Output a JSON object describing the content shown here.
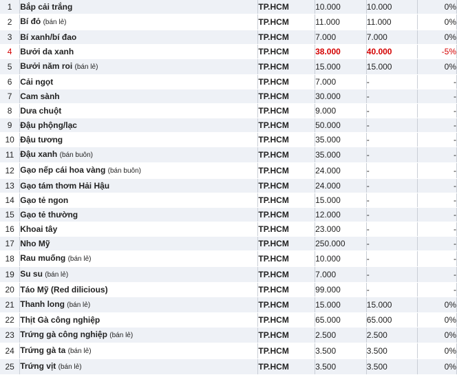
{
  "colors": {
    "row_alt": "#eef1f6",
    "row_white": "#ffffff",
    "highlight": "#d40000",
    "text": "#222222"
  },
  "rows": [
    {
      "stt": "1",
      "name": "Bắp cải trắng",
      "note": "",
      "location": "TP.HCM",
      "price1": "10.000",
      "price2": "10.000",
      "change": "0%"
    },
    {
      "stt": "2",
      "name": "Bí đỏ",
      "note": "(bán lẻ)",
      "location": "TP.HCM",
      "price1": "11.000",
      "price2": "11.000",
      "change": "0%"
    },
    {
      "stt": "3",
      "name": "Bí xanh/bí đao",
      "note": "",
      "location": "TP.HCM",
      "price1": "7.000",
      "price2": "7.000",
      "change": "0%"
    },
    {
      "stt": "4",
      "name": "Bưởi da xanh",
      "note": "",
      "location": "TP.HCM",
      "price1": "38.000",
      "price2": "40.000",
      "change": "-5%",
      "highlight": true
    },
    {
      "stt": "5",
      "name": "Bưởi năm roi",
      "note": "(bán lẻ)",
      "location": "TP.HCM",
      "price1": "15.000",
      "price2": "15.000",
      "change": "0%"
    },
    {
      "stt": "6",
      "name": "Cải ngọt",
      "note": "",
      "location": "TP.HCM",
      "price1": "7.000",
      "price2": "-",
      "change": "-"
    },
    {
      "stt": "7",
      "name": "Cam sành",
      "note": "",
      "location": "TP.HCM",
      "price1": "30.000",
      "price2": "-",
      "change": "-"
    },
    {
      "stt": "8",
      "name": "Dưa chuột",
      "note": "",
      "location": "TP.HCM",
      "price1": "9.000",
      "price2": "-",
      "change": "-"
    },
    {
      "stt": "9",
      "name": "Đậu phộng/lạc",
      "note": "",
      "location": "TP.HCM",
      "price1": "50.000",
      "price2": "-",
      "change": "-"
    },
    {
      "stt": "10",
      "name": "Đậu tương",
      "note": "",
      "location": "TP.HCM",
      "price1": "35.000",
      "price2": "-",
      "change": "-"
    },
    {
      "stt": "11",
      "name": "Đậu xanh",
      "note": "(bán buôn)",
      "location": "TP.HCM",
      "price1": "35.000",
      "price2": "-",
      "change": "-"
    },
    {
      "stt": "12",
      "name": "Gạo nếp cái hoa vàng",
      "note": "(bán buôn)",
      "location": "TP.HCM",
      "price1": "24.000",
      "price2": "-",
      "change": "-"
    },
    {
      "stt": "13",
      "name": "Gạo tám thơm Hải Hậu",
      "note": "",
      "location": "TP.HCM",
      "price1": "24.000",
      "price2": "-",
      "change": "-"
    },
    {
      "stt": "14",
      "name": "Gạo tẻ ngon",
      "note": "",
      "location": "TP.HCM",
      "price1": "15.000",
      "price2": "-",
      "change": "-"
    },
    {
      "stt": "15",
      "name": "Gạo tẻ thường",
      "note": "",
      "location": "TP.HCM",
      "price1": "12.000",
      "price2": "-",
      "change": "-"
    },
    {
      "stt": "16",
      "name": "Khoai tây",
      "note": "",
      "location": "TP.HCM",
      "price1": "23.000",
      "price2": "-",
      "change": "-"
    },
    {
      "stt": "17",
      "name": "Nho Mỹ",
      "note": "",
      "location": "TP.HCM",
      "price1": "250.000",
      "price2": "-",
      "change": "-"
    },
    {
      "stt": "18",
      "name": "Rau muống",
      "note": "(bán lẻ)",
      "location": "TP.HCM",
      "price1": "10.000",
      "price2": "-",
      "change": "-"
    },
    {
      "stt": "19",
      "name": "Su su",
      "note": "(bán lẻ)",
      "location": "TP.HCM",
      "price1": "7.000",
      "price2": "-",
      "change": "-"
    },
    {
      "stt": "20",
      "name": "Táo Mỹ (Red dilicious)",
      "note": "",
      "location": "TP.HCM",
      "price1": "99.000",
      "price2": "-",
      "change": "-"
    },
    {
      "stt": "21",
      "name": "Thanh long",
      "note": "(bán lẻ)",
      "location": "TP.HCM",
      "price1": "15.000",
      "price2": "15.000",
      "change": "0%"
    },
    {
      "stt": "22",
      "name": "Thịt Gà công nghiệp",
      "note": "",
      "location": "TP.HCM",
      "price1": "65.000",
      "price2": "65.000",
      "change": "0%"
    },
    {
      "stt": "23",
      "name": "Trứng gà công nghiệp",
      "note": "(bán lẻ)",
      "location": "TP.HCM",
      "price1": "2.500",
      "price2": "2.500",
      "change": "0%"
    },
    {
      "stt": "24",
      "name": "Trứng gà ta",
      "note": "(bán lẻ)",
      "location": "TP.HCM",
      "price1": "3.500",
      "price2": "3.500",
      "change": "0%"
    },
    {
      "stt": "25",
      "name": "Trứng vịt",
      "note": "(bán lẻ)",
      "location": "TP.HCM",
      "price1": "3.500",
      "price2": "3.500",
      "change": "0%"
    }
  ]
}
